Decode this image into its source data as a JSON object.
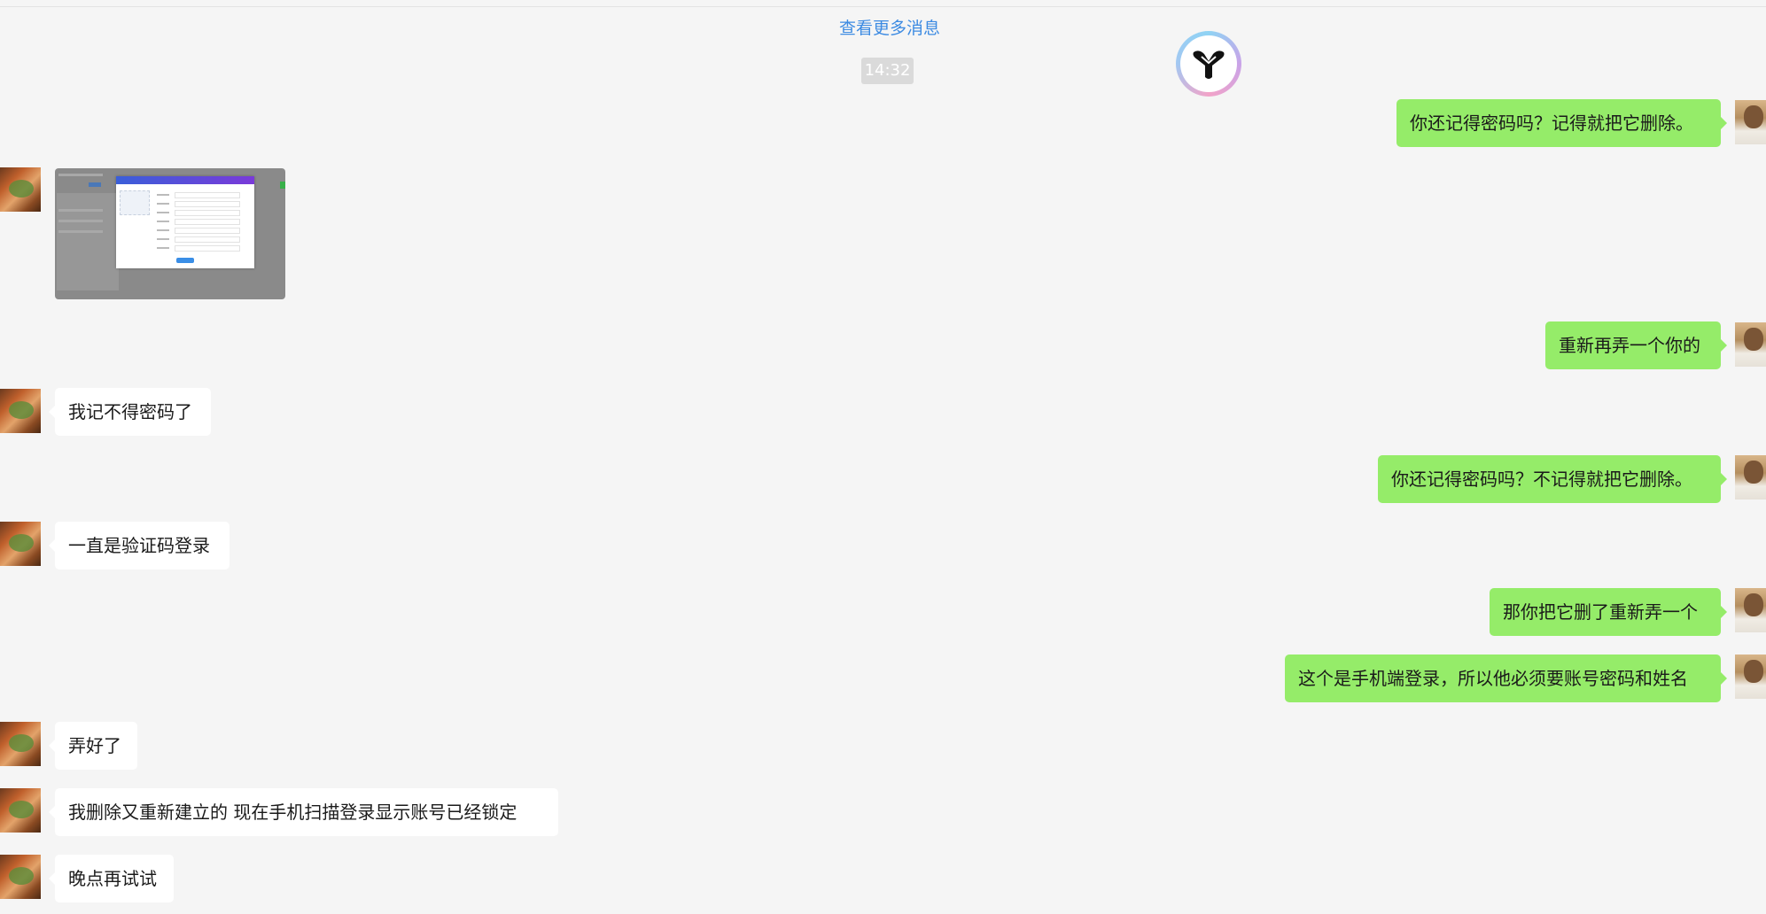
{
  "header": {
    "more_messages_link": "查看更多消息",
    "timestamp": "14:32"
  },
  "messages": [
    {
      "side": "right",
      "type": "text",
      "text": "你还记得密码吗？记得就把它删除。"
    },
    {
      "side": "left",
      "type": "image",
      "text": ""
    },
    {
      "side": "right",
      "type": "text",
      "text": "重新再弄一个你的"
    },
    {
      "side": "left",
      "type": "text",
      "text": "我记不得密码了"
    },
    {
      "side": "right",
      "type": "text",
      "text": "你还记得密码吗？不记得就把它删除。"
    },
    {
      "side": "left",
      "type": "text",
      "text": "一直是验证码登录"
    },
    {
      "side": "right",
      "type": "text",
      "text": "那你把它删了重新弄一个"
    },
    {
      "side": "right",
      "type": "text",
      "text": "这个是手机端登录，所以他必须要账号密码和姓名"
    },
    {
      "side": "left",
      "type": "text",
      "text": "弄好了"
    },
    {
      "side": "left",
      "type": "text",
      "text": "我删除又重新建立的  现在手机扫描登录显示账号已经锁定"
    },
    {
      "side": "left",
      "type": "text",
      "text": "晚点再试试"
    }
  ],
  "colors": {
    "background": "#f5f5f5",
    "self_bubble": "#95ec69",
    "other_bubble": "#ffffff",
    "link": "#3d8be2",
    "timestamp_bg": "#dadada"
  },
  "icons": {
    "floating_logo": "assistant-logo-icon",
    "image_thumbnail": "screenshot-image"
  }
}
